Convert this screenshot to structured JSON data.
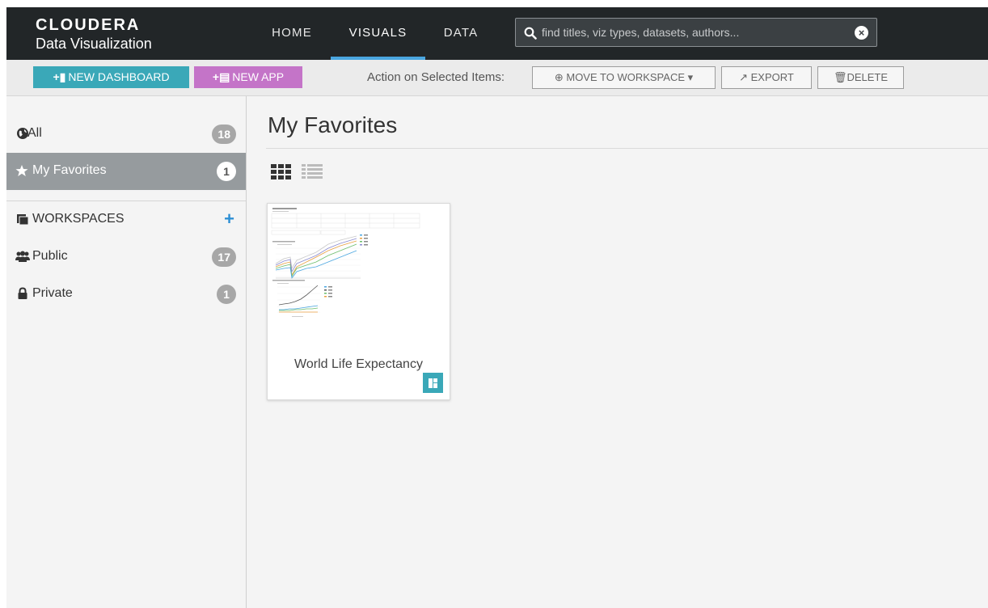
{
  "header": {
    "brand": "CLOUDERA",
    "product": "Data Visualization",
    "nav": [
      {
        "label": "HOME",
        "active": false
      },
      {
        "label": "VISUALS",
        "active": true
      },
      {
        "label": "DATA",
        "active": false
      }
    ],
    "search_placeholder": "find titles, viz types, datasets, authors..."
  },
  "actionbar": {
    "new_dashboard": "NEW DASHBOARD",
    "new_app": "NEW APP",
    "action_label": "Action on Selected Items:",
    "move_to_workspace": "MOVE TO WORKSPACE",
    "export": "EXPORT",
    "delete": "DELETE"
  },
  "sidebar": {
    "all": {
      "label": "All",
      "count": "18"
    },
    "favorites": {
      "label": "My Favorites",
      "count": "1"
    },
    "workspaces": "WORKSPACES",
    "public": {
      "label": "Public",
      "count": "17"
    },
    "private": {
      "label": "Private",
      "count": "1"
    }
  },
  "main": {
    "title": "My Favorites",
    "cards": [
      {
        "title": "World Life Expectancy",
        "type_icon": "dashboard-icon"
      }
    ]
  },
  "colors": {
    "accent_blue": "#4aa6e0",
    "dashboard_teal": "#3aa8b8",
    "app_purple": "#c474c8",
    "topbar": "#222628"
  }
}
